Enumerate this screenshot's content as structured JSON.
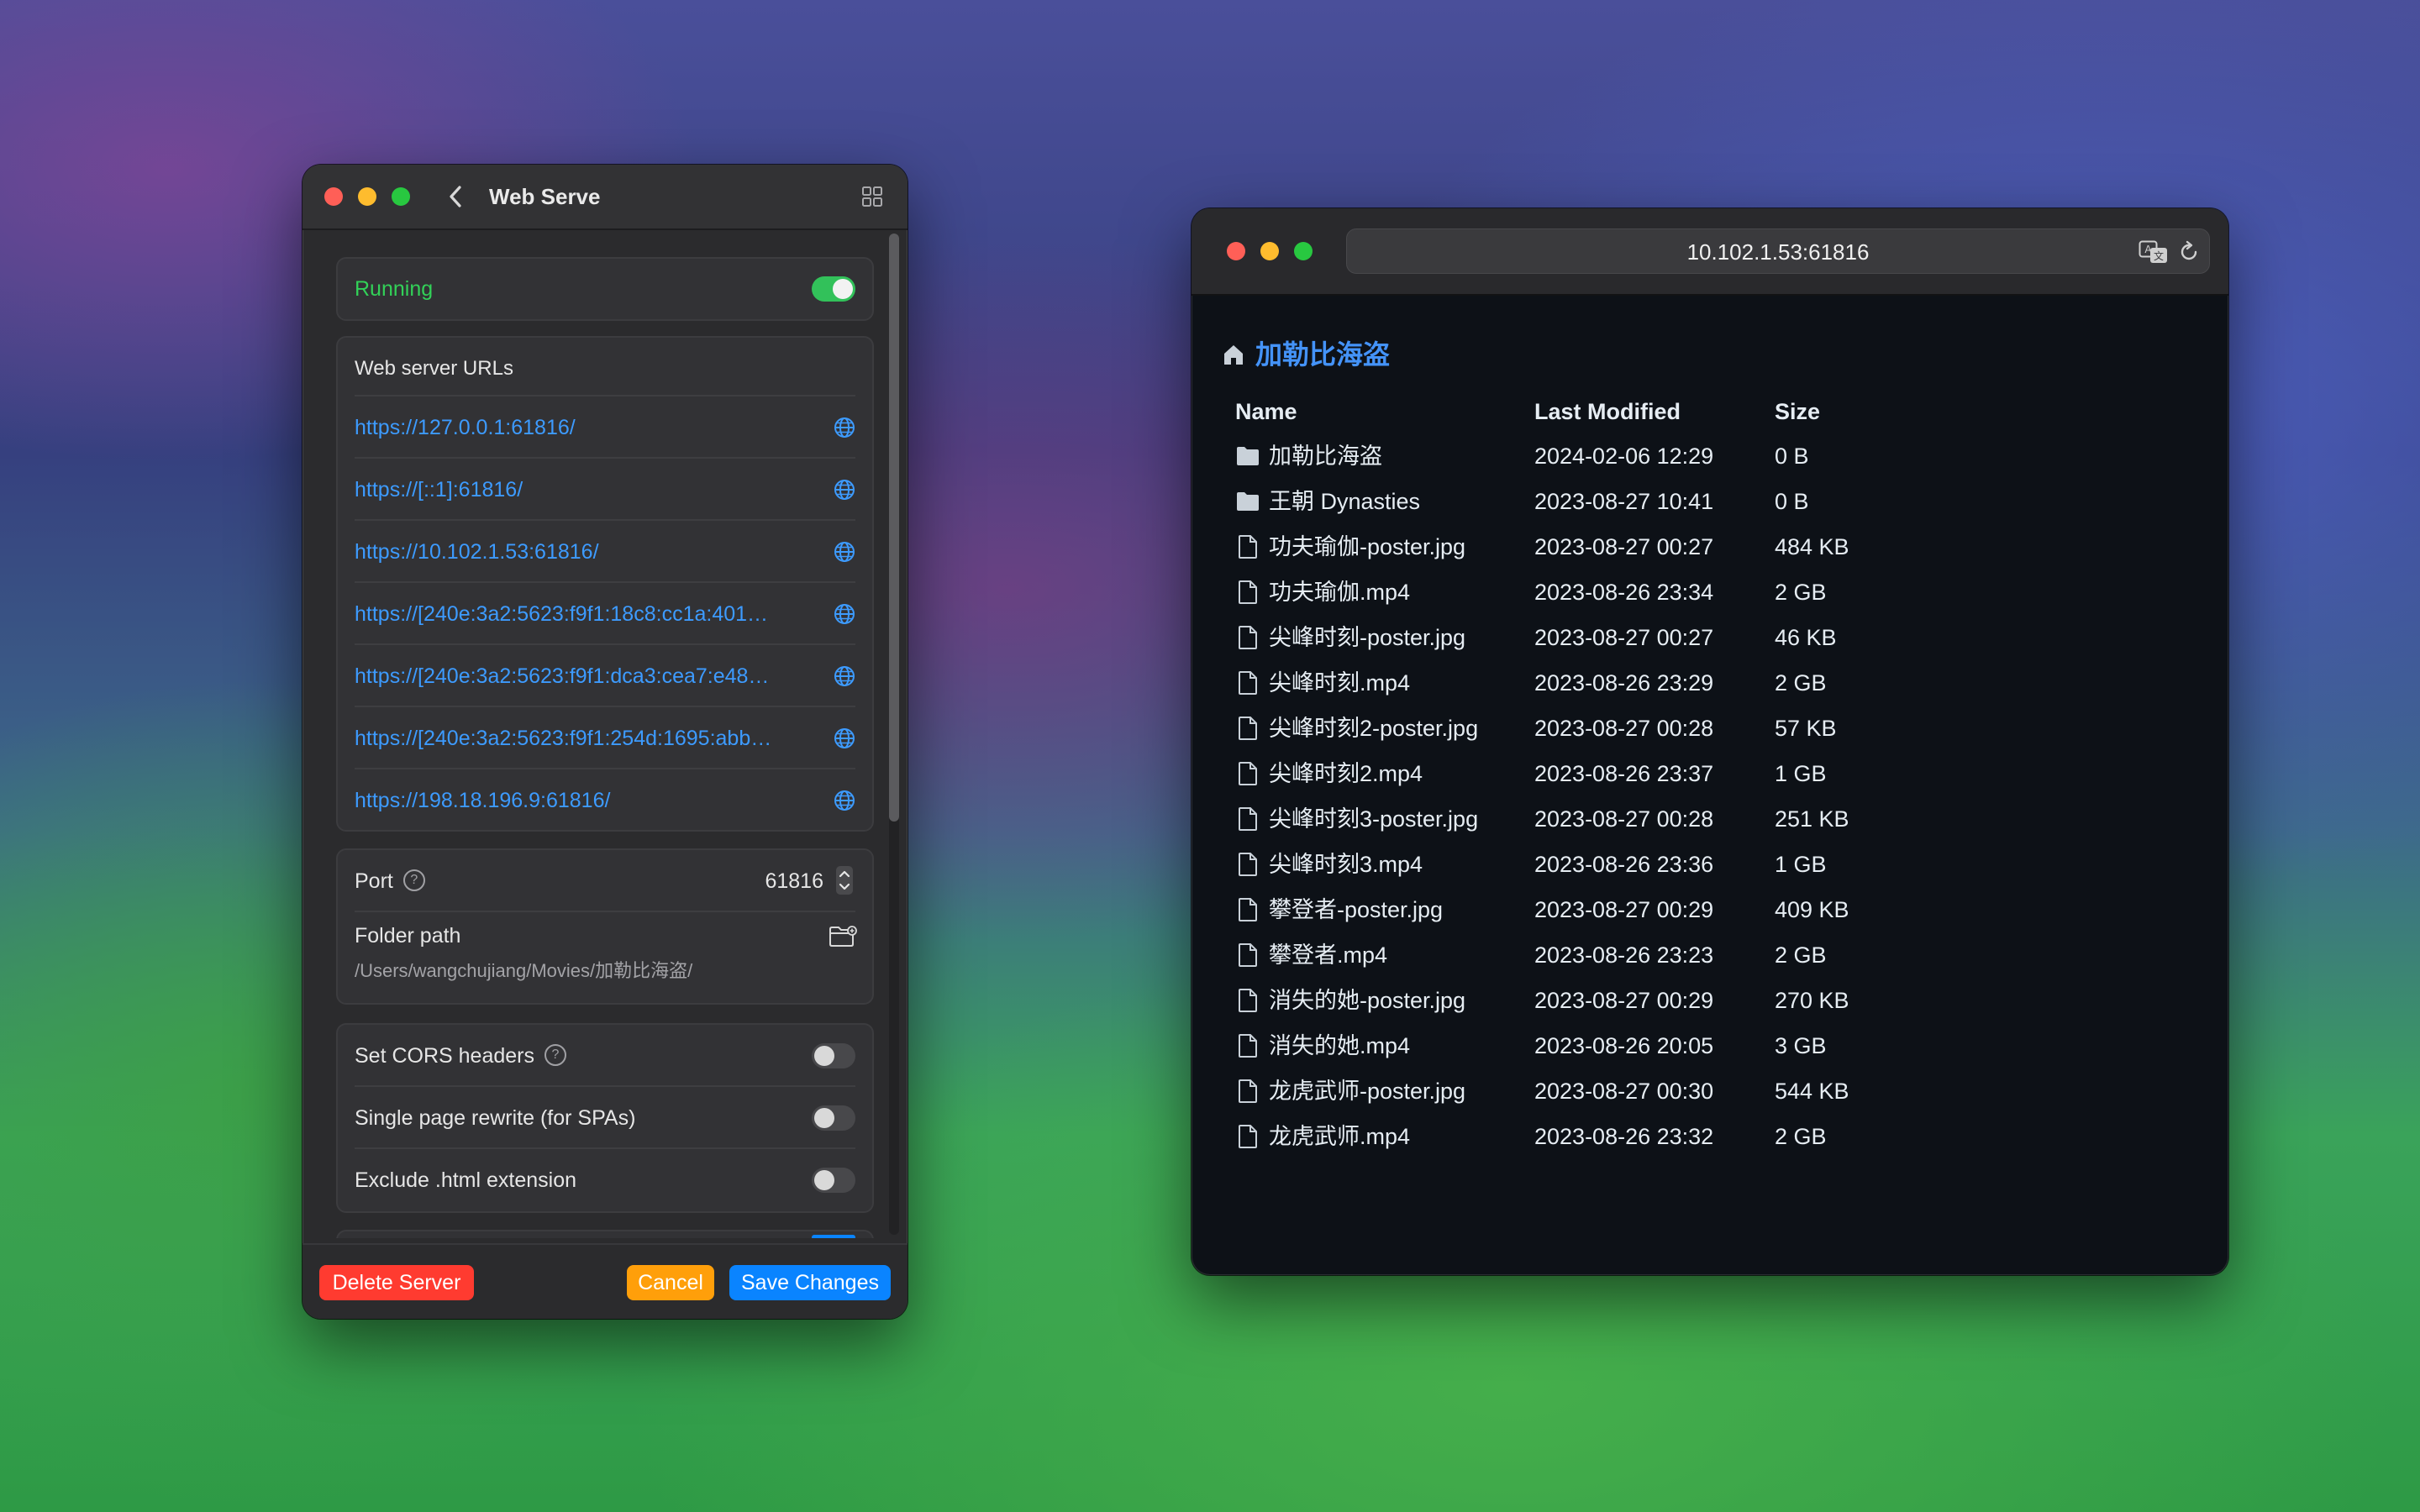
{
  "web_serve_window": {
    "title": "Web Serve",
    "status": {
      "label": "Running",
      "enabled": true
    },
    "urls_header": "Web server URLs",
    "urls": [
      "https://127.0.0.1:61816/",
      "https://[::1]:61816/",
      "https://10.102.1.53:61816/",
      "https://[240e:3a2:5623:f9f1:18c8:cc1a:401…",
      "https://[240e:3a2:5623:f9f1:dca3:cea7:e48…",
      "https://[240e:3a2:5623:f9f1:254d:1695:abb…",
      "https://198.18.196.9:61816/"
    ],
    "port": {
      "label": "Port",
      "value": "61816"
    },
    "folder": {
      "label": "Folder path",
      "value": "/Users/wangchujiang/Movies/加勒比海盗/"
    },
    "options": [
      {
        "label": "Set CORS headers",
        "enabled": false,
        "has_help": true
      },
      {
        "label": "Single page rewrite (for SPAs)",
        "enabled": false,
        "has_help": false
      },
      {
        "label": "Exclude .html extension",
        "enabled": false,
        "has_help": false
      }
    ],
    "buttons": {
      "delete": "Delete Server",
      "cancel": "Cancel",
      "save": "Save Changes"
    },
    "colors": {
      "accent": "#3d9bff",
      "running": "#32d158",
      "delete": "#ff3b30",
      "cancel": "#ff9f0a",
      "save": "#0a84ff"
    }
  },
  "browser_window": {
    "address": "10.102.1.53:61816",
    "breadcrumb": "加勒比海盗",
    "columns": {
      "name": "Name",
      "modified": "Last Modified",
      "size": "Size"
    },
    "files": [
      {
        "icon": "folder-icon",
        "name": "加勒比海盗",
        "modified": "2024-02-06 12:29",
        "size": "0 B"
      },
      {
        "icon": "folder-icon",
        "name": "王朝 Dynasties",
        "modified": "2023-08-27 10:41",
        "size": "0 B"
      },
      {
        "icon": "file-icon",
        "name": "功夫瑜伽-poster.jpg",
        "modified": "2023-08-27 00:27",
        "size": "484 KB"
      },
      {
        "icon": "file-icon",
        "name": "功夫瑜伽.mp4",
        "modified": "2023-08-26 23:34",
        "size": "2 GB"
      },
      {
        "icon": "file-icon",
        "name": "尖峰时刻-poster.jpg",
        "modified": "2023-08-27 00:27",
        "size": "46 KB"
      },
      {
        "icon": "file-icon",
        "name": "尖峰时刻.mp4",
        "modified": "2023-08-26 23:29",
        "size": "2 GB"
      },
      {
        "icon": "file-icon",
        "name": "尖峰时刻2-poster.jpg",
        "modified": "2023-08-27 00:28",
        "size": "57 KB"
      },
      {
        "icon": "file-icon",
        "name": "尖峰时刻2.mp4",
        "modified": "2023-08-26 23:37",
        "size": "1 GB"
      },
      {
        "icon": "file-icon",
        "name": "尖峰时刻3-poster.jpg",
        "modified": "2023-08-27 00:28",
        "size": "251 KB"
      },
      {
        "icon": "file-icon",
        "name": "尖峰时刻3.mp4",
        "modified": "2023-08-26 23:36",
        "size": "1 GB"
      },
      {
        "icon": "file-icon",
        "name": "攀登者-poster.jpg",
        "modified": "2023-08-27 00:29",
        "size": "409 KB"
      },
      {
        "icon": "file-icon",
        "name": "攀登者.mp4",
        "modified": "2023-08-26 23:23",
        "size": "2 GB"
      },
      {
        "icon": "file-icon",
        "name": "消失的她-poster.jpg",
        "modified": "2023-08-27 00:29",
        "size": "270 KB"
      },
      {
        "icon": "file-icon",
        "name": "消失的她.mp4",
        "modified": "2023-08-26 20:05",
        "size": "3 GB"
      },
      {
        "icon": "file-icon",
        "name": "龙虎武师-poster.jpg",
        "modified": "2023-08-27 00:30",
        "size": "544 KB"
      },
      {
        "icon": "file-icon",
        "name": "龙虎武师.mp4",
        "modified": "2023-08-26 23:32",
        "size": "2 GB"
      }
    ],
    "colors": {
      "link": "#4493f8",
      "background": "#0d1117"
    }
  }
}
